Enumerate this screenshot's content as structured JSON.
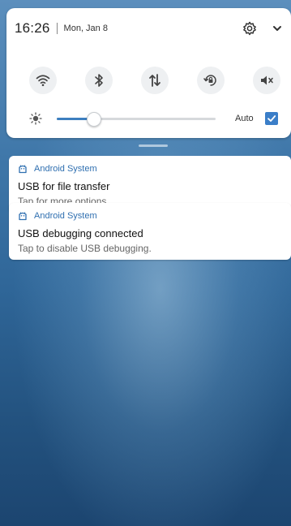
{
  "status": {
    "time": "16:26",
    "date": "Mon, Jan 8"
  },
  "quick_settings": {
    "toggles": [
      "wifi-icon",
      "bluetooth-icon",
      "mobile-data-icon",
      "auto-rotate-icon",
      "mute-icon"
    ],
    "brightness": {
      "level": 0.23,
      "auto_label": "Auto",
      "auto_checked": true
    }
  },
  "notifications": [
    {
      "app": "Android System",
      "title": "USB for file transfer",
      "text": "Tap for more options."
    },
    {
      "app": "Android System",
      "title": "USB debugging connected",
      "text": "Tap to disable USB debugging."
    }
  ],
  "colors": {
    "accent": "#3b7ec8",
    "app_name": "#2f6fb0"
  }
}
